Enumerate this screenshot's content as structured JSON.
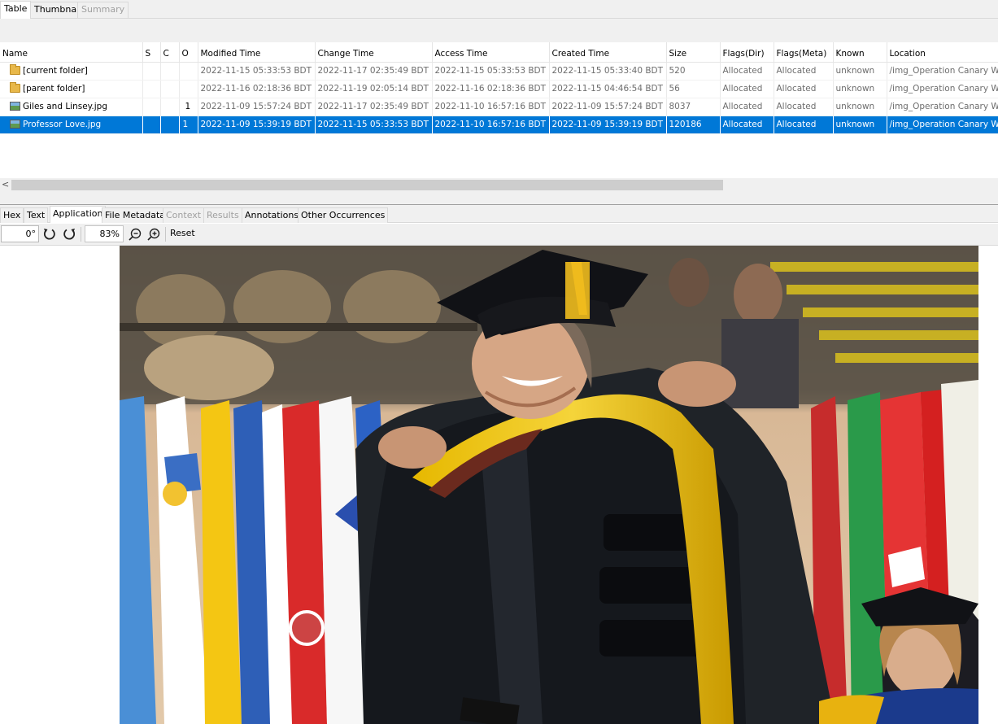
{
  "top_tabs": [
    {
      "label": "Table"
    },
    {
      "label": "Thumbnail"
    },
    {
      "label": "Summary"
    }
  ],
  "table": {
    "columns": [
      "Name",
      "S",
      "C",
      "O",
      "Modified Time",
      "Change Time",
      "Access Time",
      "Created Time",
      "Size",
      "Flags(Dir)",
      "Flags(Meta)",
      "Known",
      "Location"
    ],
    "rows": [
      {
        "icon": "folder-icon",
        "name": "[current folder]",
        "s": "",
        "c": "",
        "o": "",
        "modified": "2022-11-15 05:33:53 BDT",
        "change": "2022-11-17 02:35:49 BDT",
        "access": "2022-11-15 05:33:53 BDT",
        "created": "2022-11-15 05:33:40 BDT",
        "size": "520",
        "flags_dir": "Allocated",
        "flags_meta": "Allocated",
        "known": "unknown",
        "location": "/img_Operation Canary Wha"
      },
      {
        "icon": "folder-icon",
        "name": "[parent folder]",
        "s": "",
        "c": "",
        "o": "",
        "modified": "2022-11-16 02:18:36 BDT",
        "change": "2022-11-19 02:05:14 BDT",
        "access": "2022-11-16 02:18:36 BDT",
        "created": "2022-11-15 04:46:54 BDT",
        "size": "56",
        "flags_dir": "Allocated",
        "flags_meta": "Allocated",
        "known": "unknown",
        "location": "/img_Operation Canary Wha"
      },
      {
        "icon": "image-file-icon",
        "name": "Giles and Linsey.jpg",
        "s": "",
        "c": "",
        "o": "1",
        "modified": "2022-11-09 15:57:24 BDT",
        "change": "2022-11-17 02:35:49 BDT",
        "access": "2022-11-10 16:57:16 BDT",
        "created": "2022-11-09 15:57:24 BDT",
        "size": "8037",
        "flags_dir": "Allocated",
        "flags_meta": "Allocated",
        "known": "unknown",
        "location": "/img_Operation Canary Wha"
      },
      {
        "icon": "image-file-icon",
        "name": "Professor Love.jpg",
        "s": "",
        "c": "",
        "o": "1",
        "modified": "2022-11-09 15:39:19 BDT",
        "change": "2022-11-15 05:33:53 BDT",
        "access": "2022-11-10 16:57:16 BDT",
        "created": "2022-11-09 15:39:19 BDT",
        "size": "120186",
        "flags_dir": "Allocated",
        "flags_meta": "Allocated",
        "known": "unknown",
        "location": "/img_Operation Canary Wha"
      }
    ]
  },
  "viewer_tabs": [
    {
      "label": "Hex"
    },
    {
      "label": "Text"
    },
    {
      "label": "Application"
    },
    {
      "label": "File Metadata"
    },
    {
      "label": "Context"
    },
    {
      "label": "Results"
    },
    {
      "label": "Annotations"
    },
    {
      "label": "Other Occurrences"
    }
  ],
  "toolbar": {
    "rotation": "0°",
    "zoom": "83%",
    "reset_label": "Reset"
  },
  "colors": {
    "selection": "#0078d7",
    "panel_bg": "#f0f0f0",
    "disabled_text": "#a0a0a0"
  }
}
